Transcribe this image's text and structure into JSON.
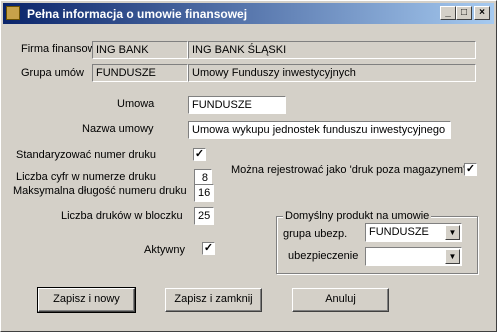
{
  "window": {
    "title": "Pełna informacja o umowie finansowej"
  },
  "titlebar_buttons": {
    "minimize": "_",
    "maximize": "□",
    "close": "×"
  },
  "firma": {
    "label": "Firma finansowa",
    "code": "ING BANK",
    "name": "ING BANK ŚLĄSKI"
  },
  "grupa": {
    "label": "Grupa umów",
    "code": "FUNDUSZE",
    "name": "Umowy Funduszy inwestycyjnych"
  },
  "umowa": {
    "label": "Umowa",
    "value": "FUNDUSZE"
  },
  "nazwa": {
    "label": "Nazwa umowy",
    "value": "Umowa wykupu jednostek funduszu inwestycyjnego"
  },
  "standaryzowac": {
    "label": "Standaryzować numer druku",
    "checked": "✓"
  },
  "druk_poza": {
    "label": "Można rejestrować jako 'druk poza magazynem'",
    "checked": "✓"
  },
  "liczba_cyfr": {
    "label": "Liczba cyfr w numerze druku",
    "value": "8"
  },
  "max_dlugosc": {
    "label": "Maksymalna długość numeru druku",
    "value": "16"
  },
  "liczba_drukow": {
    "label": "Liczba druków w bloczku",
    "value": "25"
  },
  "aktywny": {
    "label": "Aktywny",
    "checked": "✓"
  },
  "produkt": {
    "group_title": "Domyślny produkt na umowie",
    "grupa_label": "grupa ubezp.",
    "grupa_value": "FUNDUSZE",
    "ubezp_label": "ubezpieczenie",
    "ubezp_value": "",
    "arrow": "▼"
  },
  "buttons": {
    "save_new": "Zapisz i nowy",
    "save_close": "Zapisz i zamknij",
    "cancel": "Anuluj"
  }
}
